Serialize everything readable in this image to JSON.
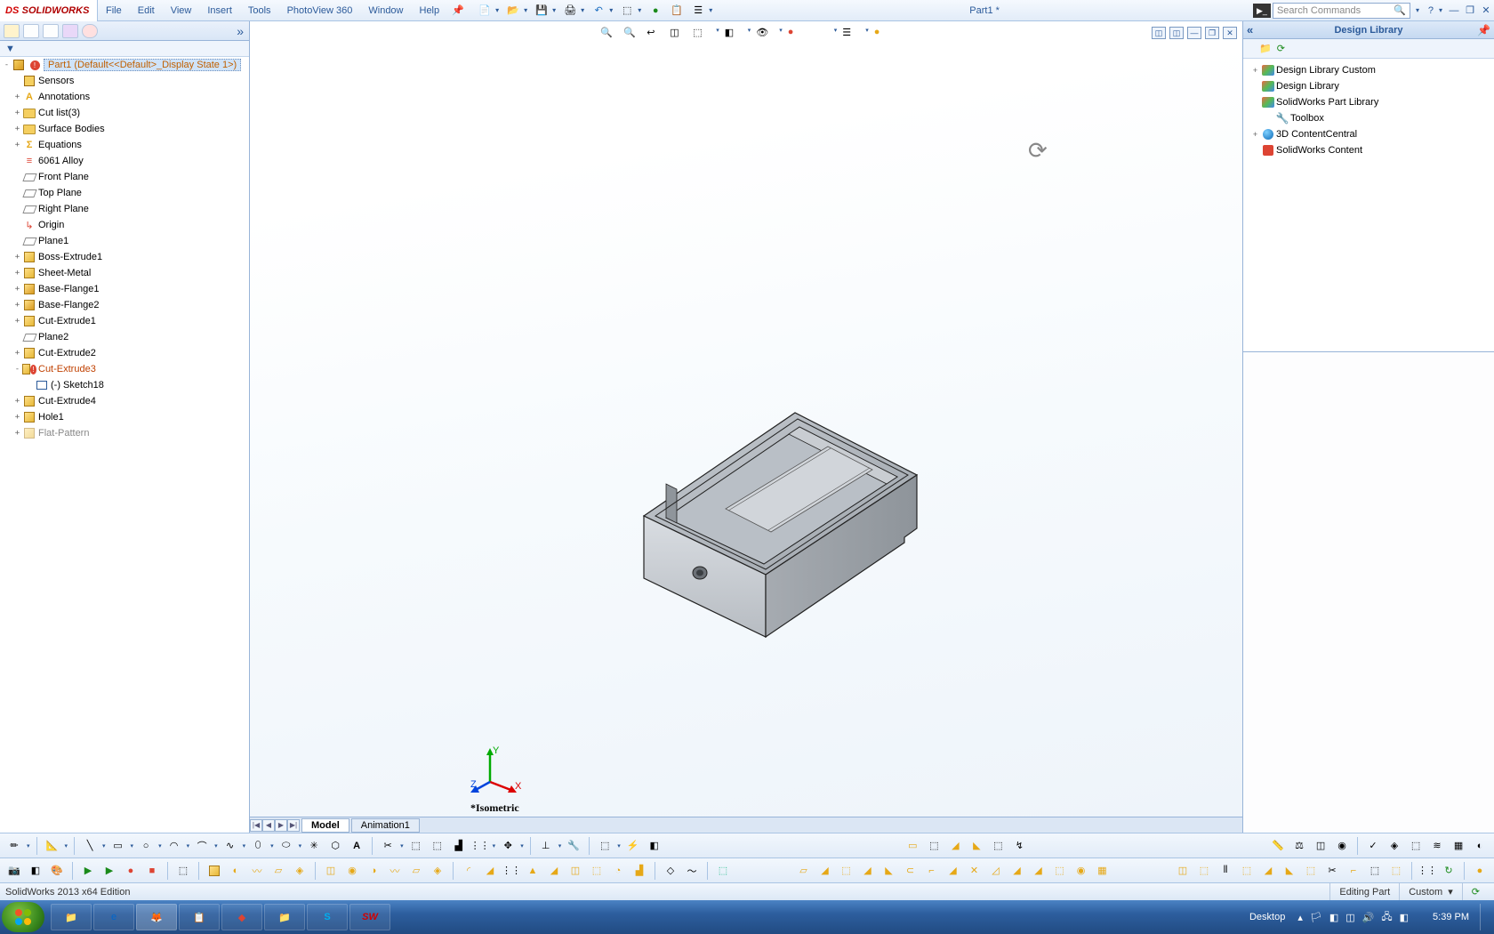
{
  "app": {
    "logo_text": "SOLIDWORKS",
    "document_title": "Part1 *"
  },
  "menu": [
    "File",
    "Edit",
    "View",
    "Insert",
    "Tools",
    "PhotoView 360",
    "Window",
    "Help"
  ],
  "search": {
    "placeholder": "Search Commands"
  },
  "feature_tree": {
    "root": "Part1  (Default<<Default>_Display State 1>)",
    "items": [
      {
        "level": 1,
        "expand": "",
        "icon": "sensors",
        "label": "Sensors"
      },
      {
        "level": 1,
        "expand": "+",
        "icon": "annot",
        "label": "Annotations"
      },
      {
        "level": 1,
        "expand": "+",
        "icon": "cutlist",
        "label": "Cut list(3)"
      },
      {
        "level": 1,
        "expand": "+",
        "icon": "surf",
        "label": "Surface Bodies"
      },
      {
        "level": 1,
        "expand": "+",
        "icon": "eq",
        "label": "Equations"
      },
      {
        "level": 1,
        "expand": "",
        "icon": "material",
        "label": "6061 Alloy"
      },
      {
        "level": 1,
        "expand": "",
        "icon": "plane",
        "label": "Front Plane"
      },
      {
        "level": 1,
        "expand": "",
        "icon": "plane",
        "label": "Top Plane"
      },
      {
        "level": 1,
        "expand": "",
        "icon": "plane",
        "label": "Right Plane"
      },
      {
        "level": 1,
        "expand": "",
        "icon": "origin",
        "label": "Origin"
      },
      {
        "level": 1,
        "expand": "",
        "icon": "plane",
        "label": "Plane1"
      },
      {
        "level": 1,
        "expand": "+",
        "icon": "extrude",
        "label": "Boss-Extrude1"
      },
      {
        "level": 1,
        "expand": "+",
        "icon": "sheetmetal",
        "label": "Sheet-Metal"
      },
      {
        "level": 1,
        "expand": "+",
        "icon": "flange",
        "label": "Base-Flange1"
      },
      {
        "level": 1,
        "expand": "+",
        "icon": "flange",
        "label": "Base-Flange2"
      },
      {
        "level": 1,
        "expand": "+",
        "icon": "cutext",
        "label": "Cut-Extrude1"
      },
      {
        "level": 1,
        "expand": "",
        "icon": "plane",
        "label": "Plane2"
      },
      {
        "level": 1,
        "expand": "+",
        "icon": "cutext",
        "label": "Cut-Extrude2"
      },
      {
        "level": 1,
        "expand": "-",
        "icon": "cutext-err",
        "label": "Cut-Extrude3",
        "err": true
      },
      {
        "level": 2,
        "expand": "",
        "icon": "sketch",
        "label": "(-) Sketch18"
      },
      {
        "level": 1,
        "expand": "+",
        "icon": "cutext",
        "label": "Cut-Extrude4"
      },
      {
        "level": 1,
        "expand": "+",
        "icon": "hole",
        "label": "Hole1"
      },
      {
        "level": 1,
        "expand": "+",
        "icon": "flat",
        "label": "Flat-Pattern",
        "grey": true
      }
    ]
  },
  "viewport": {
    "label": "*Isometric"
  },
  "bottom_tabs": {
    "nav": [
      "|◀",
      "◀",
      "▶",
      "▶|"
    ],
    "tabs": [
      "Model",
      "Animation1"
    ],
    "active": 0
  },
  "design_library": {
    "title": "Design Library",
    "items": [
      {
        "level": 0,
        "expand": "+",
        "icon": "multi",
        "label": "Design Library Custom"
      },
      {
        "level": 0,
        "expand": "",
        "icon": "multi",
        "label": "Design Library"
      },
      {
        "level": 0,
        "expand": "",
        "icon": "multi",
        "label": "SolidWorks Part Library"
      },
      {
        "level": 1,
        "expand": "",
        "icon": "toolbox",
        "label": "Toolbox"
      },
      {
        "level": 0,
        "expand": "+",
        "icon": "globe",
        "label": "3D ContentCentral"
      },
      {
        "level": 0,
        "expand": "",
        "icon": "red",
        "label": "SolidWorks Content"
      }
    ]
  },
  "status": {
    "left": "SolidWorks 2013 x64 Edition",
    "editing": "Editing Part",
    "units": "Custom"
  },
  "taskbar": {
    "desktop_label": "Desktop",
    "time": "5:39 PM"
  }
}
